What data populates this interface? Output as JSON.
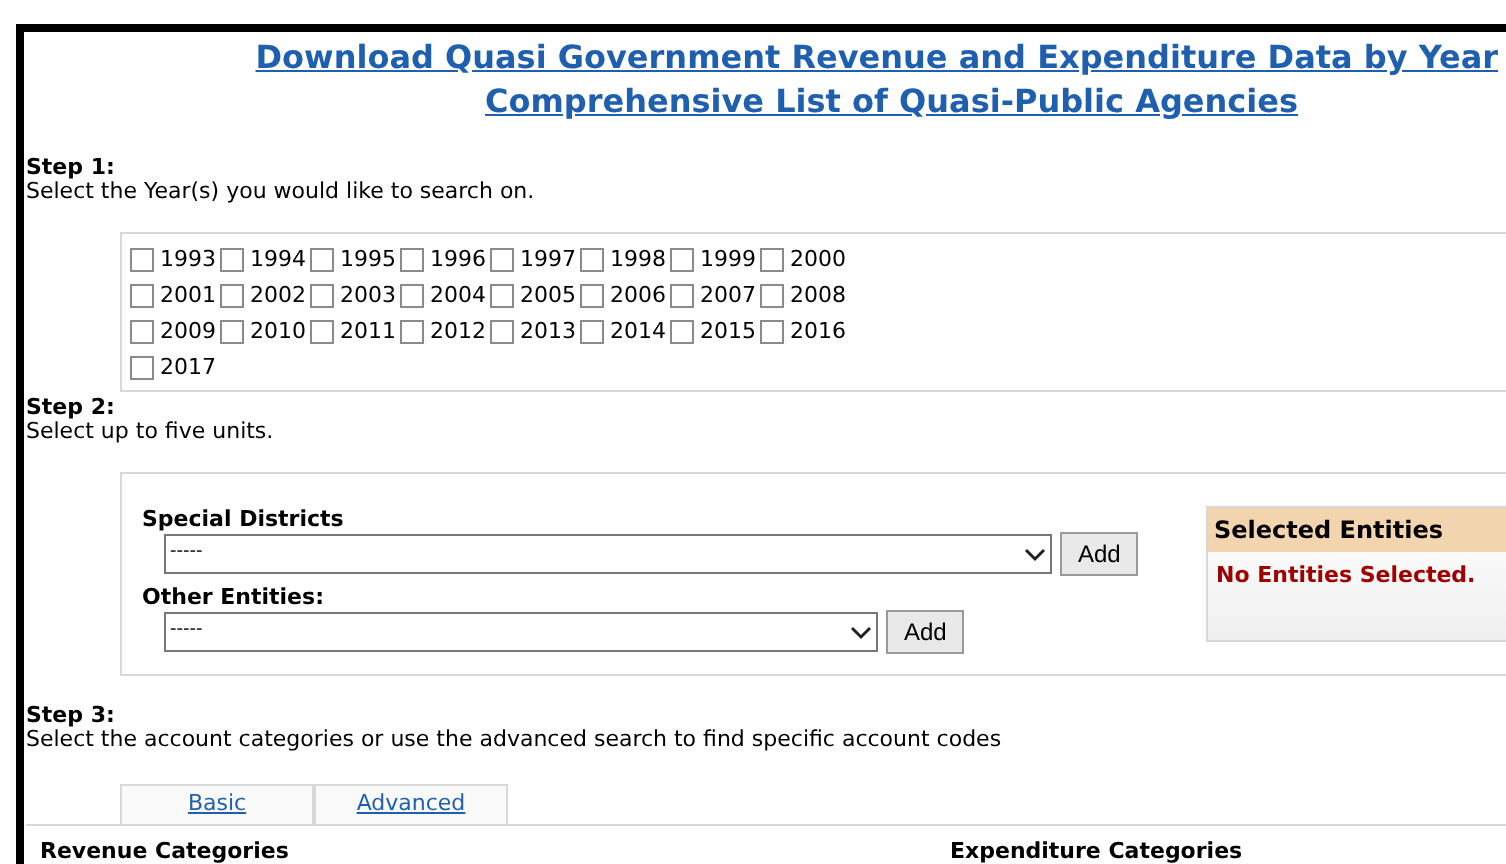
{
  "header_links": [
    "Download Quasi Government Revenue and Expenditure Data by Year",
    "Comprehensive List of Quasi-Public Agencies"
  ],
  "step1": {
    "title": "Step 1:",
    "instruction": "Select the Year(s) you would like to search on.",
    "years": [
      {
        "label": "1993",
        "checked": false
      },
      {
        "label": "1994",
        "checked": false
      },
      {
        "label": "1995",
        "checked": false
      },
      {
        "label": "1996",
        "checked": false
      },
      {
        "label": "1997",
        "checked": false
      },
      {
        "label": "1998",
        "checked": false
      },
      {
        "label": "1999",
        "checked": false
      },
      {
        "label": "2000",
        "checked": false
      },
      {
        "label": "2001",
        "checked": false
      },
      {
        "label": "2002",
        "checked": false
      },
      {
        "label": "2003",
        "checked": false
      },
      {
        "label": "2004",
        "checked": false
      },
      {
        "label": "2005",
        "checked": false
      },
      {
        "label": "2006",
        "checked": false
      },
      {
        "label": "2007",
        "checked": false
      },
      {
        "label": "2008",
        "checked": false
      },
      {
        "label": "2009",
        "checked": false
      },
      {
        "label": "2010",
        "checked": false
      },
      {
        "label": "2011",
        "checked": false
      },
      {
        "label": "2012",
        "checked": false
      },
      {
        "label": "2013",
        "checked": false
      },
      {
        "label": "2014",
        "checked": false
      },
      {
        "label": "2015",
        "checked": false
      },
      {
        "label": "2016",
        "checked": false
      },
      {
        "label": "2017",
        "checked": false
      }
    ]
  },
  "step2": {
    "title": "Step 2:",
    "instruction": "Select up to five units.",
    "selectors": [
      {
        "label": "Special Districts",
        "value": "-----",
        "button": "Add"
      },
      {
        "label": "Other Entities:",
        "value": "-----",
        "button": "Add"
      }
    ],
    "selected_entities": {
      "title": "Selected Entities",
      "message": "No Entities Selected."
    }
  },
  "step3": {
    "title": "Step 3:",
    "instruction": "Select the account categories or use the advanced search to find specific account codes",
    "tabs": [
      "Basic",
      "Advanced"
    ],
    "columns": [
      "Revenue Categories",
      "Expenditure Categories"
    ]
  }
}
